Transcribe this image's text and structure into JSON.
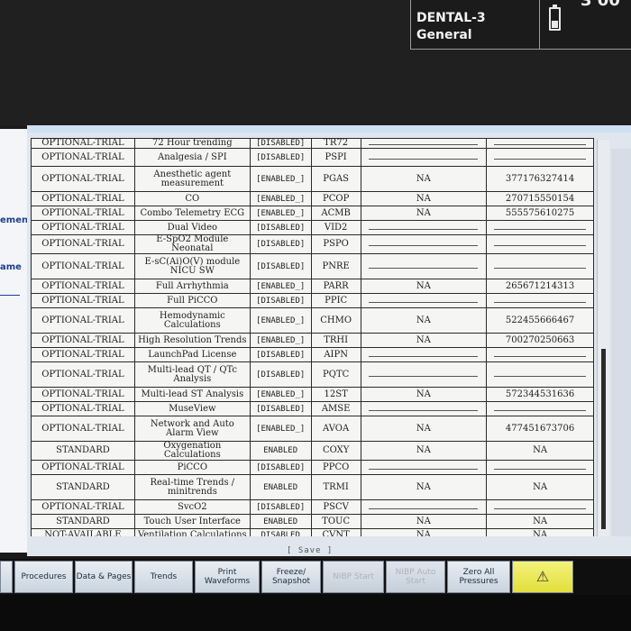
{
  "header": {
    "patient_name": "DENTAL-3",
    "patient_category": "General",
    "clock_partial": "3 00"
  },
  "left_window": {
    "label_1": "ement",
    "label_2": "ame"
  },
  "table": {
    "rows": [
      [
        "OPTIONAL-TRIAL",
        "72 Hour trending",
        "[DISABLED]",
        "TR72",
        "",
        ""
      ],
      [
        "OPTIONAL-TRIAL",
        "Analgesia / SPI",
        "[DISABLED]",
        "PSPI",
        "",
        ""
      ],
      [
        "OPTIONAL-TRIAL",
        "Anesthetic agent measurement",
        "[ENABLED_]",
        "PGAS",
        "NA",
        "377176327414"
      ],
      [
        "OPTIONAL-TRIAL",
        "CO",
        "[ENABLED_]",
        "PCOP",
        "NA",
        "270715550154"
      ],
      [
        "OPTIONAL-TRIAL",
        "Combo Telemetry ECG",
        "[ENABLED_]",
        "ACMB",
        "NA",
        "555575610275"
      ],
      [
        "OPTIONAL-TRIAL",
        "Dual Video",
        "[DISABLED]",
        "VID2",
        "",
        ""
      ],
      [
        "OPTIONAL-TRIAL",
        "E-SpO2 Module Neonatal",
        "[DISABLED]",
        "PSPO",
        "",
        ""
      ],
      [
        "OPTIONAL-TRIAL",
        "E-sC(Ai)O(V) module NICU SW",
        "[DISABLED]",
        "PNRE",
        "",
        ""
      ],
      [
        "OPTIONAL-TRIAL",
        "Full Arrhythmia",
        "[ENABLED_]",
        "PARR",
        "NA",
        "265671214313"
      ],
      [
        "OPTIONAL-TRIAL",
        "Full PiCCO",
        "[DISABLED]",
        "PPIC",
        "",
        ""
      ],
      [
        "OPTIONAL-TRIAL",
        "Hemodynamic Calculations",
        "[ENABLED_]",
        "CHMO",
        "NA",
        "522455666467"
      ],
      [
        "OPTIONAL-TRIAL",
        "High Resolution Trends",
        "[ENABLED_]",
        "TRHI",
        "NA",
        "700270250663"
      ],
      [
        "OPTIONAL-TRIAL",
        "LaunchPad License",
        "[DISABLED]",
        "AIPN",
        "",
        ""
      ],
      [
        "OPTIONAL-TRIAL",
        "Multi-lead QT / QTc Analysis",
        "[DISABLED]",
        "PQTC",
        "",
        ""
      ],
      [
        "OPTIONAL-TRIAL",
        "Multi-lead ST Analysis",
        "[ENABLED_]",
        "12ST",
        "NA",
        "572344531636"
      ],
      [
        "OPTIONAL-TRIAL",
        "MuseView",
        "[DISABLED]",
        "AMSE",
        "",
        ""
      ],
      [
        "OPTIONAL-TRIAL",
        "Network and Auto Alarm View",
        "[ENABLED_]",
        "AVOA",
        "NA",
        "477451673706"
      ],
      [
        "STANDARD",
        "Oxygenation Calculations",
        "ENABLED",
        "COXY",
        "NA",
        "NA"
      ],
      [
        "OPTIONAL-TRIAL",
        "PiCCO",
        "[DISABLED]",
        "PPCO",
        "",
        ""
      ],
      [
        "STANDARD",
        "Real-time Trends / minitrends",
        "ENABLED",
        "TRMI",
        "NA",
        "NA"
      ],
      [
        "OPTIONAL-TRIAL",
        "SvcO2",
        "[DISABLED]",
        "PSCV",
        "",
        ""
      ],
      [
        "STANDARD",
        "Touch User Interface",
        "ENABLED",
        "TOUC",
        "NA",
        "NA"
      ],
      [
        "NOT-AVAILABLE",
        "Ventilation Calculations",
        "DISABLED",
        "CVNT",
        "NA",
        "NA"
      ]
    ]
  },
  "dialog": {
    "save_label": "[ Save ]"
  },
  "bottom_bar": {
    "buttons": [
      {
        "label": "",
        "state": "normal"
      },
      {
        "label": "Procedures",
        "state": "normal"
      },
      {
        "label": "Data & Pages",
        "state": "normal"
      },
      {
        "label": "Trends",
        "state": "normal"
      },
      {
        "label": "Print Waveforms",
        "state": "normal"
      },
      {
        "label": "Freeze/ Snapshot",
        "state": "normal"
      },
      {
        "label": "NIBP Start",
        "state": "disabled"
      },
      {
        "label": "NIBP Auto Start",
        "state": "disabled"
      },
      {
        "label": "Zero All Pressures",
        "state": "normal"
      },
      {
        "label": "",
        "state": "alarm"
      }
    ]
  },
  "colors": {
    "panel_bg": "#dfe6ee",
    "table_bg": "#f5f5f3",
    "left_label": "#1c3f91",
    "alarm_button": "#e8e54a"
  }
}
